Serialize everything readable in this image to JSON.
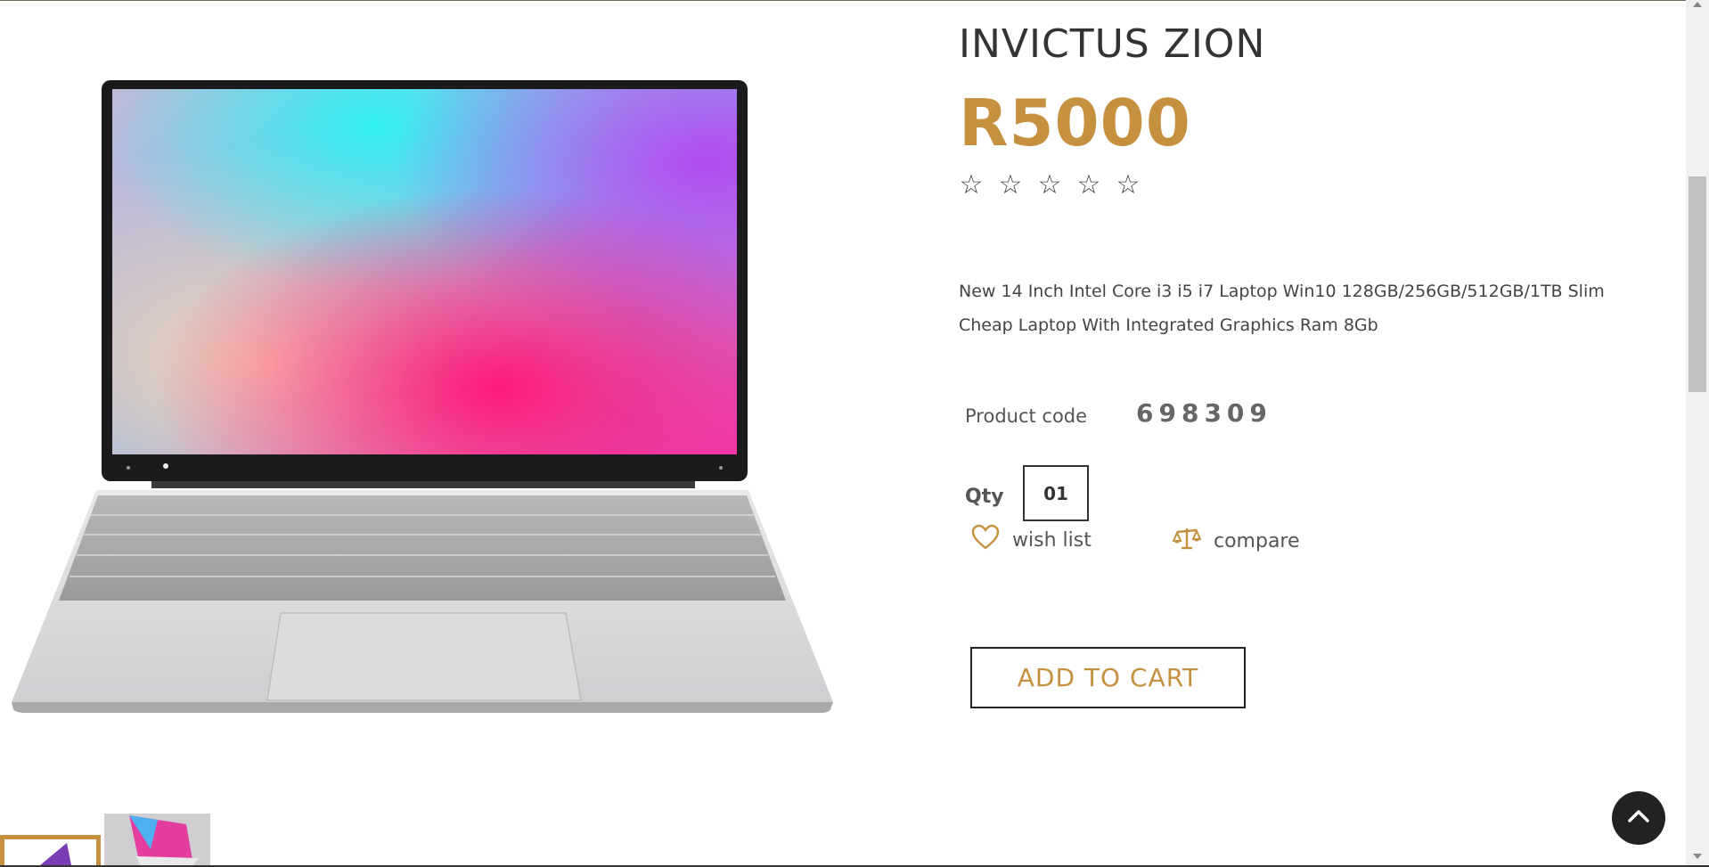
{
  "product": {
    "title": "INVICTUS ZION",
    "price": "R5000",
    "rating": 0,
    "rating_max": 5,
    "stars": [
      "☆",
      "☆",
      "☆",
      "☆",
      "☆"
    ],
    "description": "New 14 Inch Intel Core i3 i5 i7 Laptop Win10 128GB/256GB/512GB/1TB Slim Cheap Laptop With Integrated Graphics Ram 8Gb",
    "code_label": "Product code",
    "code_value": "698309",
    "qty_label": "Qty",
    "qty_value": "01",
    "wishlist_label": "wish list",
    "compare_label": "compare",
    "add_to_cart_label": "ADD TO CART"
  },
  "icons": {
    "wishlist": "heart-icon",
    "compare": "scale-icon",
    "back_to_top": "chevron-up-icon"
  },
  "colors": {
    "accent": "#c6913f",
    "text": "#555555",
    "dark": "#222222"
  }
}
